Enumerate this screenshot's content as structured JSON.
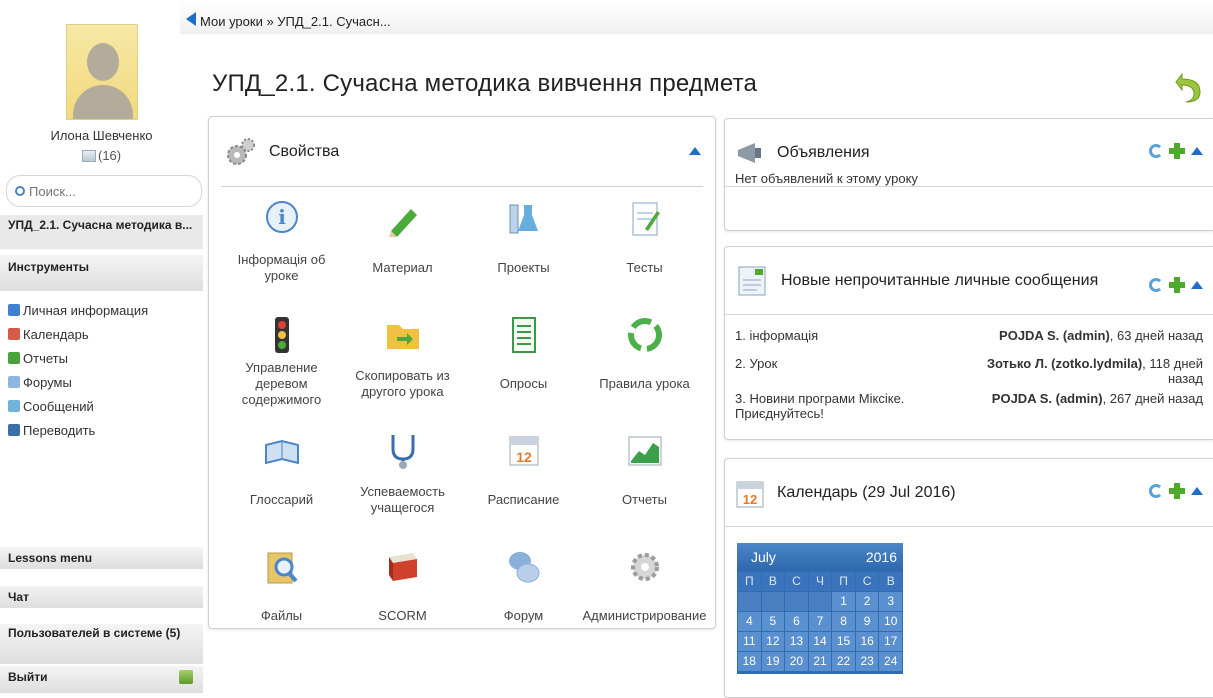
{
  "user": {
    "name": "Илона Шевченко",
    "messages": "(16)"
  },
  "search": {
    "placeholder": "Поиск..."
  },
  "sidebar": {
    "course_short": "УПД_2.1. Сучасна методика в...",
    "tools_header": "Инструменты",
    "tools": [
      {
        "label": "Личная информация",
        "icon": "personal-info-icon",
        "color": "#3d7fd0"
      },
      {
        "label": "Календарь",
        "icon": "calendar-icon",
        "color": "#d65a4a"
      },
      {
        "label": "Отчеты",
        "icon": "reports-icon",
        "color": "#4aa33a"
      },
      {
        "label": "Форумы",
        "icon": "forums-icon",
        "color": "#8fb6e0"
      },
      {
        "label": "Сообщений",
        "icon": "messages-icon",
        "color": "#6fb3d9"
      },
      {
        "label": "Переводить",
        "icon": "translate-icon",
        "color": "#3b6ea8"
      }
    ],
    "lessons_menu": "Lessons menu",
    "chat": "Чат",
    "online_users": "Пользователей в системе  (5)",
    "logout": "Выйти"
  },
  "breadcrumb": "Мои уроки » УПД_2.1. Сучасн...",
  "page_title": "УПД_2.1. Сучасна методика вивчення предмета",
  "properties": {
    "title": "Свойства",
    "tools": [
      {
        "label": "Інформація об уроке",
        "icon": "info-icon",
        "color": "#4a86c9"
      },
      {
        "label": "Материал",
        "icon": "pencil-icon",
        "color": "#4caa3a"
      },
      {
        "label": "Проекты",
        "icon": "flask-icon",
        "color": "#3e9ad6"
      },
      {
        "label": "Тесты",
        "icon": "test-sheet-icon",
        "color": "#79a8d4"
      },
      {
        "label": "Управление деревом содержимого",
        "icon": "traffic-light-icon",
        "color": "#333333"
      },
      {
        "label": "Скопировать из другого урока",
        "icon": "folder-copy-icon",
        "color": "#f0c040"
      },
      {
        "label": "Опросы",
        "icon": "survey-icon",
        "color": "#3a9a4a"
      },
      {
        "label": "Правила урока",
        "icon": "recycle-icon",
        "color": "#4cb04a"
      },
      {
        "label": "Глоссарий",
        "icon": "open-book-icon",
        "color": "#4a86c9"
      },
      {
        "label": "Успеваемость учащегося",
        "icon": "stethoscope-icon",
        "color": "#3a6eae"
      },
      {
        "label": "Расписание",
        "icon": "schedule-icon",
        "color": "#e07a2a"
      },
      {
        "label": "Отчеты",
        "icon": "chart-icon",
        "color": "#3aa04a"
      },
      {
        "label": "Файлы",
        "icon": "file-search-icon",
        "color": "#e9c56a"
      },
      {
        "label": "SCORM",
        "icon": "scorm-book-icon",
        "color": "#d0402c"
      },
      {
        "label": "Форум",
        "icon": "forum-bubbles-icon",
        "color": "#8ab0dc"
      },
      {
        "label": "Администрирование",
        "icon": "gears-icon",
        "color": "#9a9a9a"
      }
    ]
  },
  "announcements": {
    "title": "Объявления",
    "empty": "Нет объявлений к этому уроку"
  },
  "private_messages": {
    "title": "Новые непрочитанные личные сообщения",
    "items": [
      {
        "subject": "1. інформація",
        "from_name": "POJDA S. (admin)",
        "when": ", 63 дней назад"
      },
      {
        "subject": "2. Урок",
        "from_name": "Зотько Л. (zotko.lydmila)",
        "when": ", 118 дней назад"
      },
      {
        "subject": "3. Новини програми Міксіке. Приєднуйтесь!",
        "from_name": "POJDA S. (admin)",
        "when": ", 267 дней назад"
      }
    ]
  },
  "calendar": {
    "title": "Календарь (29 Jul 2016)",
    "month": "July",
    "year": "2016",
    "weekdays": [
      "П",
      "В",
      "С",
      "Ч",
      "П",
      "С",
      "В"
    ],
    "rows": [
      [
        "",
        "",
        "",
        "",
        "1",
        "2",
        "3"
      ],
      [
        "4",
        "5",
        "6",
        "7",
        "8",
        "9",
        "10"
      ],
      [
        "11",
        "12",
        "13",
        "14",
        "15",
        "16",
        "17"
      ],
      [
        "18",
        "19",
        "20",
        "21",
        "22",
        "23",
        "24"
      ]
    ]
  }
}
